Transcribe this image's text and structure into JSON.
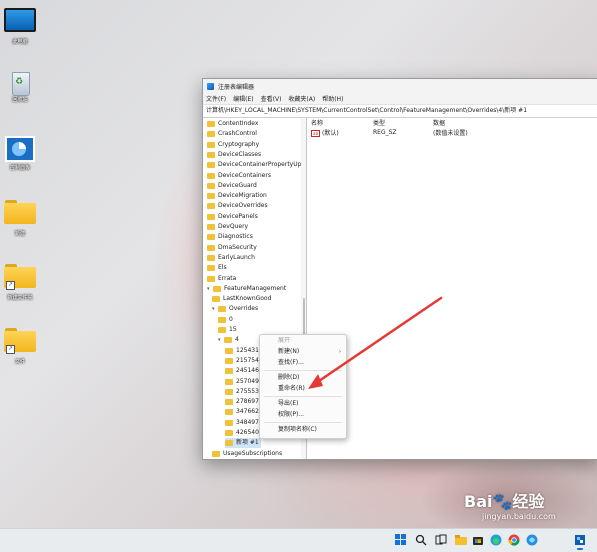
{
  "desktop": {
    "icons": [
      {
        "label": "此电脑",
        "kind": "monitor-icon"
      },
      {
        "label": "回收站",
        "kind": "recycle-bin-icon"
      },
      {
        "label": "控制面板",
        "kind": "control-panel-icon"
      },
      {
        "label": "新建",
        "kind": "folder-icon"
      },
      {
        "label": "新建文件夹",
        "kind": "folder-icon"
      },
      {
        "label": "文件",
        "kind": "folder-icon"
      }
    ]
  },
  "window": {
    "title": "注册表编辑器",
    "menu": [
      "文件(F)",
      "编辑(E)",
      "查看(V)",
      "收藏夹(A)",
      "帮助(H)"
    ],
    "address": "计算机\\HKEY_LOCAL_MACHINE\\SYSTEM\\CurrentControlSet\\Control\\FeatureManagement\\Overrides\\4\\新项 #1"
  },
  "tree": {
    "items": [
      {
        "label": "ContentIndex",
        "depth": 0
      },
      {
        "label": "CrashControl",
        "depth": 0
      },
      {
        "label": "Cryptography",
        "depth": 0
      },
      {
        "label": "DeviceClasses",
        "depth": 0
      },
      {
        "label": "DeviceContainerPropertyUpda",
        "depth": 0
      },
      {
        "label": "DeviceContainers",
        "depth": 0
      },
      {
        "label": "DeviceGuard",
        "depth": 0
      },
      {
        "label": "DeviceMigration",
        "depth": 0
      },
      {
        "label": "DeviceOverrides",
        "depth": 0
      },
      {
        "label": "DevicePanels",
        "depth": 0
      },
      {
        "label": "DevQuery",
        "depth": 0
      },
      {
        "label": "Diagnostics",
        "depth": 0
      },
      {
        "label": "DmaSecurity",
        "depth": 0
      },
      {
        "label": "EarlyLaunch",
        "depth": 0
      },
      {
        "label": "Els",
        "depth": 0
      },
      {
        "label": "Errata",
        "depth": 0
      },
      {
        "label": "FeatureManagement",
        "depth": 0,
        "expanded": true
      },
      {
        "label": "LastKnownGood",
        "depth": 1
      },
      {
        "label": "Overrides",
        "depth": 1,
        "expanded": true
      },
      {
        "label": "0",
        "depth": 2
      },
      {
        "label": "15",
        "depth": 2
      },
      {
        "label": "4",
        "depth": 2,
        "expanded": true
      },
      {
        "label": "125431",
        "depth": 3
      },
      {
        "label": "215754",
        "depth": 3
      },
      {
        "label": "245146",
        "depth": 3
      },
      {
        "label": "257049",
        "depth": 3
      },
      {
        "label": "275553",
        "depth": 3
      },
      {
        "label": "278697",
        "depth": 3
      },
      {
        "label": "347662",
        "depth": 3
      },
      {
        "label": "348497",
        "depth": 3
      },
      {
        "label": "426540",
        "depth": 3
      },
      {
        "label": "新项 #1",
        "depth": 3,
        "selected": true
      },
      {
        "label": "UsageSubscriptions",
        "depth": 1
      }
    ]
  },
  "list": {
    "headers": [
      "名称",
      "类型",
      "数据"
    ],
    "rows": [
      {
        "name": "(默认)",
        "type": "REG_SZ",
        "data": "(数值未设置)"
      }
    ]
  },
  "context_menu": {
    "items": [
      {
        "label": "展开",
        "disabled": true
      },
      {
        "label": "新建(N)",
        "submenu": true
      },
      {
        "label": "查找(F)..."
      },
      {
        "separator": true
      },
      {
        "label": "删除(D)"
      },
      {
        "label": "重命名(R)"
      },
      {
        "separator": true
      },
      {
        "label": "导出(E)"
      },
      {
        "label": "权限(P)..."
      },
      {
        "separator": true
      },
      {
        "label": "复制项名称(C)"
      }
    ]
  },
  "annotation": {
    "color": "#e53935"
  },
  "watermark": {
    "brand": "Bai",
    "mark": "经验",
    "url": "jingyan.baidu.com"
  },
  "taskbar": {
    "icons": [
      "windows-start-icon",
      "search-icon",
      "task-view-icon",
      "file-explorer-icon",
      "store-icon",
      "edge-icon",
      "chrome-icon",
      "app-icon",
      "regedit-icon"
    ]
  }
}
